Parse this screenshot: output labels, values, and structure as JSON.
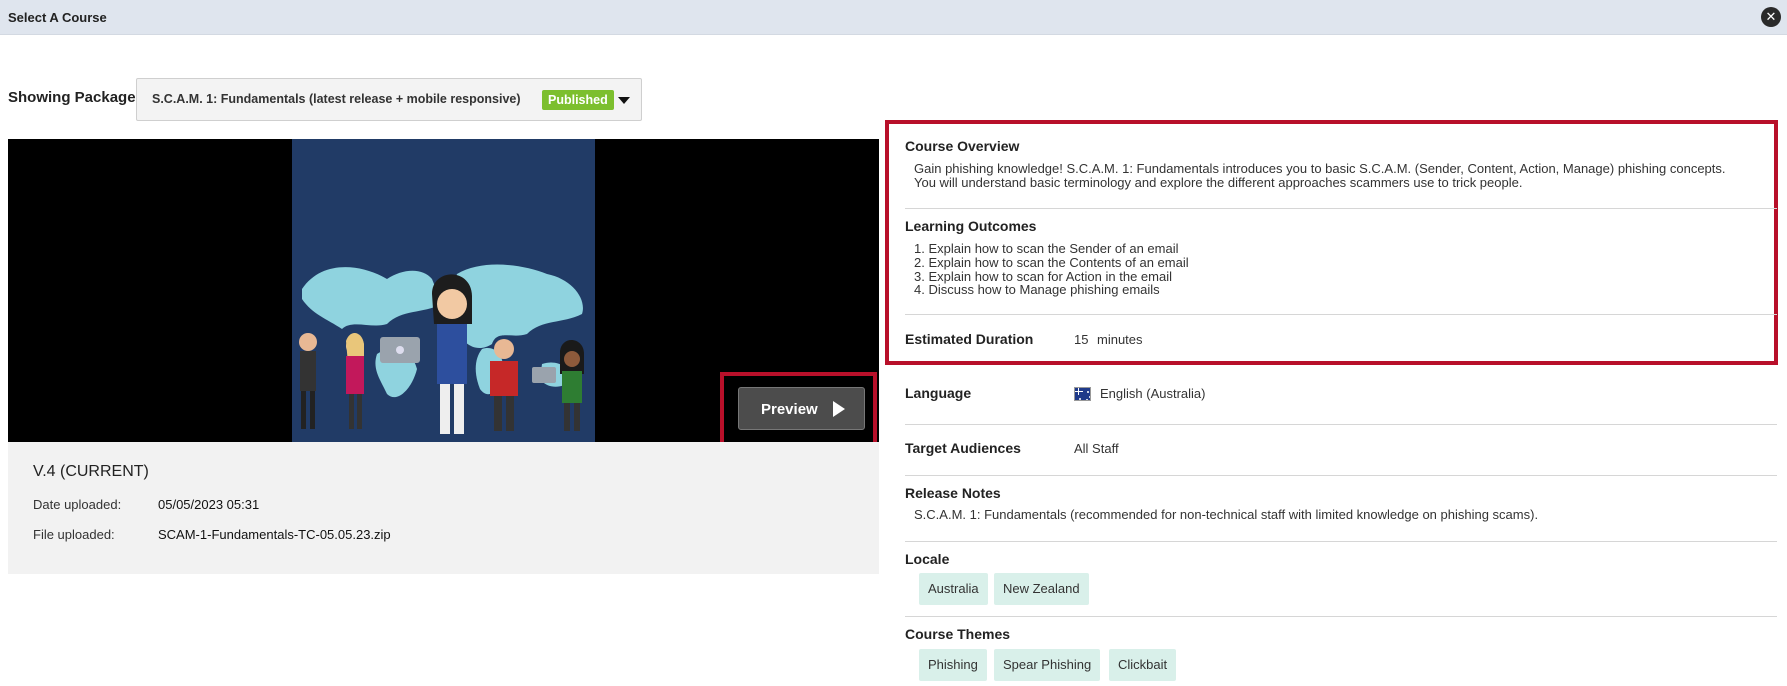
{
  "dialog": {
    "title": "Select A Course"
  },
  "package": {
    "label": "Showing Package",
    "selected": "S.C.A.M. 1: Fundamentals (latest release + mobile responsive)",
    "status": "Published"
  },
  "preview": {
    "label": "Preview"
  },
  "version": {
    "title": "V.4 (CURRENT)",
    "date_label": "Date uploaded:",
    "date_value": "05/05/2023 05:31",
    "file_label": "File uploaded:",
    "file_value": "SCAM-1-Fundamentals-TC-05.05.23.zip"
  },
  "overview": {
    "title": "Course Overview",
    "line1": "Gain phishing knowledge! S.C.A.M. 1: Fundamentals introduces you to basic S.C.A.M. (Sender, Content, Action, Manage) phishing concepts.",
    "line2": "You will understand basic terminology and explore the different approaches scammers use to trick people."
  },
  "outcomes": {
    "title": "Learning Outcomes",
    "items": [
      "1. Explain how to scan the Sender of an email",
      "2. Explain how to scan the Contents of an email",
      "3. Explain how to scan for Action in the email",
      "4. Discuss how to Manage phishing emails"
    ]
  },
  "duration": {
    "label": "Estimated Duration",
    "value": "15",
    "unit": "minutes"
  },
  "language": {
    "label": "Language",
    "value": "English (Australia)",
    "flag_icon": "australia-flag-icon"
  },
  "audiences": {
    "label": "Target Audiences",
    "value": "All Staff"
  },
  "release_notes": {
    "label": "Release Notes",
    "text": "S.C.A.M. 1: Fundamentals (recommended for non-technical staff with limited knowledge on phishing scams)."
  },
  "locale": {
    "label": "Locale",
    "chips": [
      "Australia",
      "New Zealand"
    ]
  },
  "themes": {
    "label": "Course Themes",
    "chips": [
      "Phishing",
      "Spear Phishing",
      "Clickbait"
    ]
  },
  "colors": {
    "highlight": "#b8102a",
    "published": "#7cbf2e",
    "chip": "#d9f0ea"
  }
}
